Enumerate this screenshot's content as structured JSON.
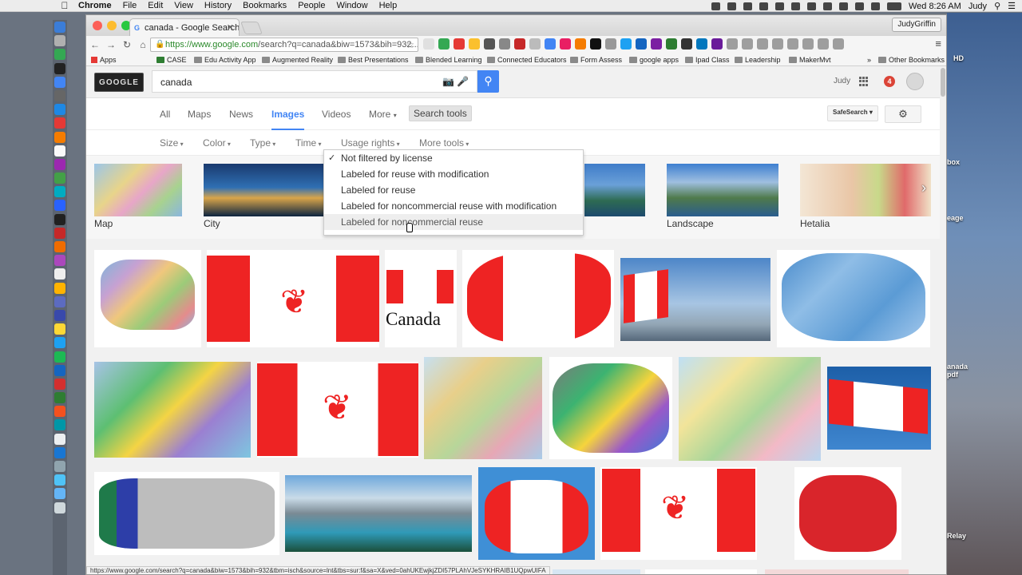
{
  "menubar": {
    "app": "Chrome",
    "items": [
      "File",
      "Edit",
      "View",
      "History",
      "Bookmarks",
      "People",
      "Window",
      "Help"
    ],
    "clock": "Wed 8:26 AM",
    "user": "Judy"
  },
  "browser": {
    "tab_title": "canada - Google Search",
    "profile": "JudyGriffin",
    "url_host": "https://www.google.com",
    "url_rest": "/search?q=canada&biw=1573&bih=932...",
    "bookmarks": [
      "Apps",
      "CASE",
      "Edu Activity App",
      "Augmented Reality",
      "Best Presentations",
      "Blended Learning",
      "Connected Educators",
      "Form Assess",
      "google apps",
      "Ipad Class",
      "Leadership",
      "MakerMvt"
    ],
    "other_bookmarks": "Other Bookmarks",
    "status_url": "https://www.google.com/search?q=canada&biw=1573&bih=932&tbm=isch&source=lnt&tbs=sur:f&sa=X&ved=0ahUKEwjkjZDI57PLAhVJeSYKHRAIB1UQpwUIFA"
  },
  "google": {
    "logo": "GOOGLE",
    "query": "canada",
    "user": "Judy",
    "notifications": "4",
    "tabs": [
      "All",
      "Maps",
      "News",
      "Images",
      "Videos",
      "More"
    ],
    "active_tab": "Images",
    "search_tools": "Search tools",
    "safesearch": "SafeSearch",
    "filters": [
      "Size",
      "Color",
      "Type",
      "Time",
      "Usage rights",
      "More tools"
    ],
    "usage_rights_options": [
      "Not filtered by license",
      "Labeled for reuse with modification",
      "Labeled for reuse",
      "Labeled for noncommercial reuse with modification",
      "Labeled for noncommercial reuse"
    ],
    "related": [
      "Map",
      "City",
      "Landscape",
      "Hetalia"
    ],
    "flag_caption": "Canada"
  },
  "desktop": {
    "labels": [
      "HD",
      "box",
      "eage",
      "anada",
      "pdf",
      "Relay"
    ]
  },
  "colors": {
    "google_blue": "#4285f4",
    "canada_red": "#ee2323",
    "notif_red": "#db4437"
  }
}
